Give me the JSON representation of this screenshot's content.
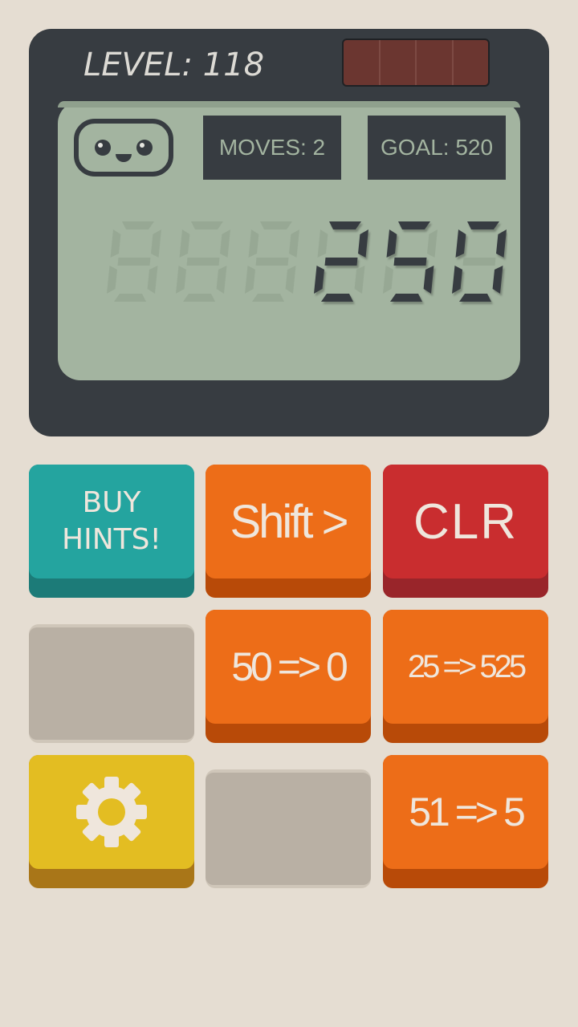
{
  "header": {
    "level_text": "LEVEL: 118"
  },
  "screen": {
    "moves_text": "MOVES: 2",
    "goal_text": "GOAL: 520",
    "display_value": "250",
    "display_digits": 6
  },
  "buttons": {
    "buy_hints": "BUY\nHINTS!",
    "shift": "Shift >",
    "clear": "CLR",
    "op1": "50 => 0",
    "op2": "25 => 525",
    "op3": "51 => 5"
  },
  "colors": {
    "device": "#373c41",
    "lcd": "#a3b4a0",
    "segment_on": "#373c41",
    "segment_off": "#97a894",
    "teal": "#24a49f",
    "orange": "#ed6d18",
    "red": "#c92d2f",
    "yellow": "#e3bd22",
    "gray": "#b9b0a4"
  },
  "icons": {
    "face": "robot-face-icon",
    "settings": "gear-icon"
  }
}
